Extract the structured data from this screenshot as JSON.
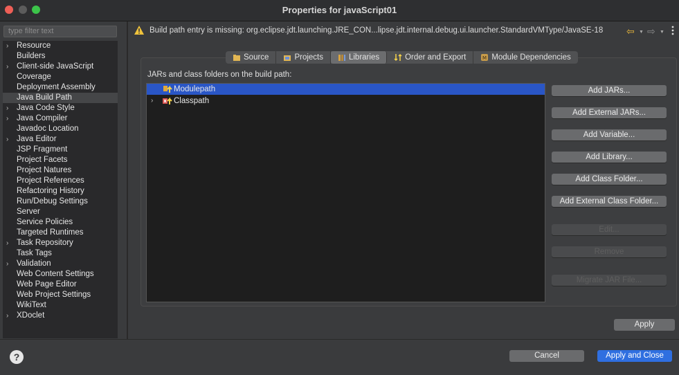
{
  "window": {
    "title": "Properties for javaScript01"
  },
  "sidebar": {
    "filter_placeholder": "type filter text",
    "items": [
      {
        "label": "Resource",
        "expandable": true
      },
      {
        "label": "Builders",
        "expandable": false
      },
      {
        "label": "Client-side JavaScript",
        "expandable": true
      },
      {
        "label": "Coverage",
        "expandable": false
      },
      {
        "label": "Deployment Assembly",
        "expandable": false
      },
      {
        "label": "Java Build Path",
        "expandable": false,
        "selected": true
      },
      {
        "label": "Java Code Style",
        "expandable": true
      },
      {
        "label": "Java Compiler",
        "expandable": true
      },
      {
        "label": "Javadoc Location",
        "expandable": false
      },
      {
        "label": "Java Editor",
        "expandable": true
      },
      {
        "label": "JSP Fragment",
        "expandable": false
      },
      {
        "label": "Project Facets",
        "expandable": false
      },
      {
        "label": "Project Natures",
        "expandable": false
      },
      {
        "label": "Project References",
        "expandable": false
      },
      {
        "label": "Refactoring History",
        "expandable": false
      },
      {
        "label": "Run/Debug Settings",
        "expandable": false
      },
      {
        "label": "Server",
        "expandable": false
      },
      {
        "label": "Service Policies",
        "expandable": false
      },
      {
        "label": "Targeted Runtimes",
        "expandable": false
      },
      {
        "label": "Task Repository",
        "expandable": true
      },
      {
        "label": "Task Tags",
        "expandable": false
      },
      {
        "label": "Validation",
        "expandable": true
      },
      {
        "label": "Web Content Settings",
        "expandable": false
      },
      {
        "label": "Web Page Editor",
        "expandable": false
      },
      {
        "label": "Web Project Settings",
        "expandable": false
      },
      {
        "label": "WikiText",
        "expandable": false
      },
      {
        "label": "XDoclet",
        "expandable": true
      }
    ]
  },
  "warning": {
    "text": "Build path entry is missing: org.eclipse.jdt.launching.JRE_CON...lipse.jdt.internal.debug.ui.launcher.StandardVMType/JavaSE-18"
  },
  "tabs": [
    {
      "label": "Source",
      "icon": "source-folder-icon"
    },
    {
      "label": "Projects",
      "icon": "projects-icon"
    },
    {
      "label": "Libraries",
      "icon": "libraries-icon",
      "active": true
    },
    {
      "label": "Order and Export",
      "icon": "order-export-icon"
    },
    {
      "label": "Module Dependencies",
      "icon": "module-icon"
    }
  ],
  "libraries": {
    "label": "JARs and class folders on the build path:",
    "entries": [
      {
        "label": "Modulepath",
        "expandable": false,
        "selected": true
      },
      {
        "label": "Classpath",
        "expandable": true,
        "selected": false
      }
    ]
  },
  "buttons": {
    "add_jars": "Add JARs...",
    "add_external_jars": "Add External JARs...",
    "add_variable": "Add Variable...",
    "add_library": "Add Library...",
    "add_class_folder": "Add Class Folder...",
    "add_external_class_folder": "Add External Class Folder...",
    "edit": "Edit...",
    "remove": "Remove",
    "migrate_jar": "Migrate JAR File...",
    "apply": "Apply",
    "cancel": "Cancel",
    "apply_and_close": "Apply and Close"
  },
  "colors": {
    "accent": "#2f6fe0",
    "selection": "#2a56c6",
    "warning": "#e8b63c"
  }
}
